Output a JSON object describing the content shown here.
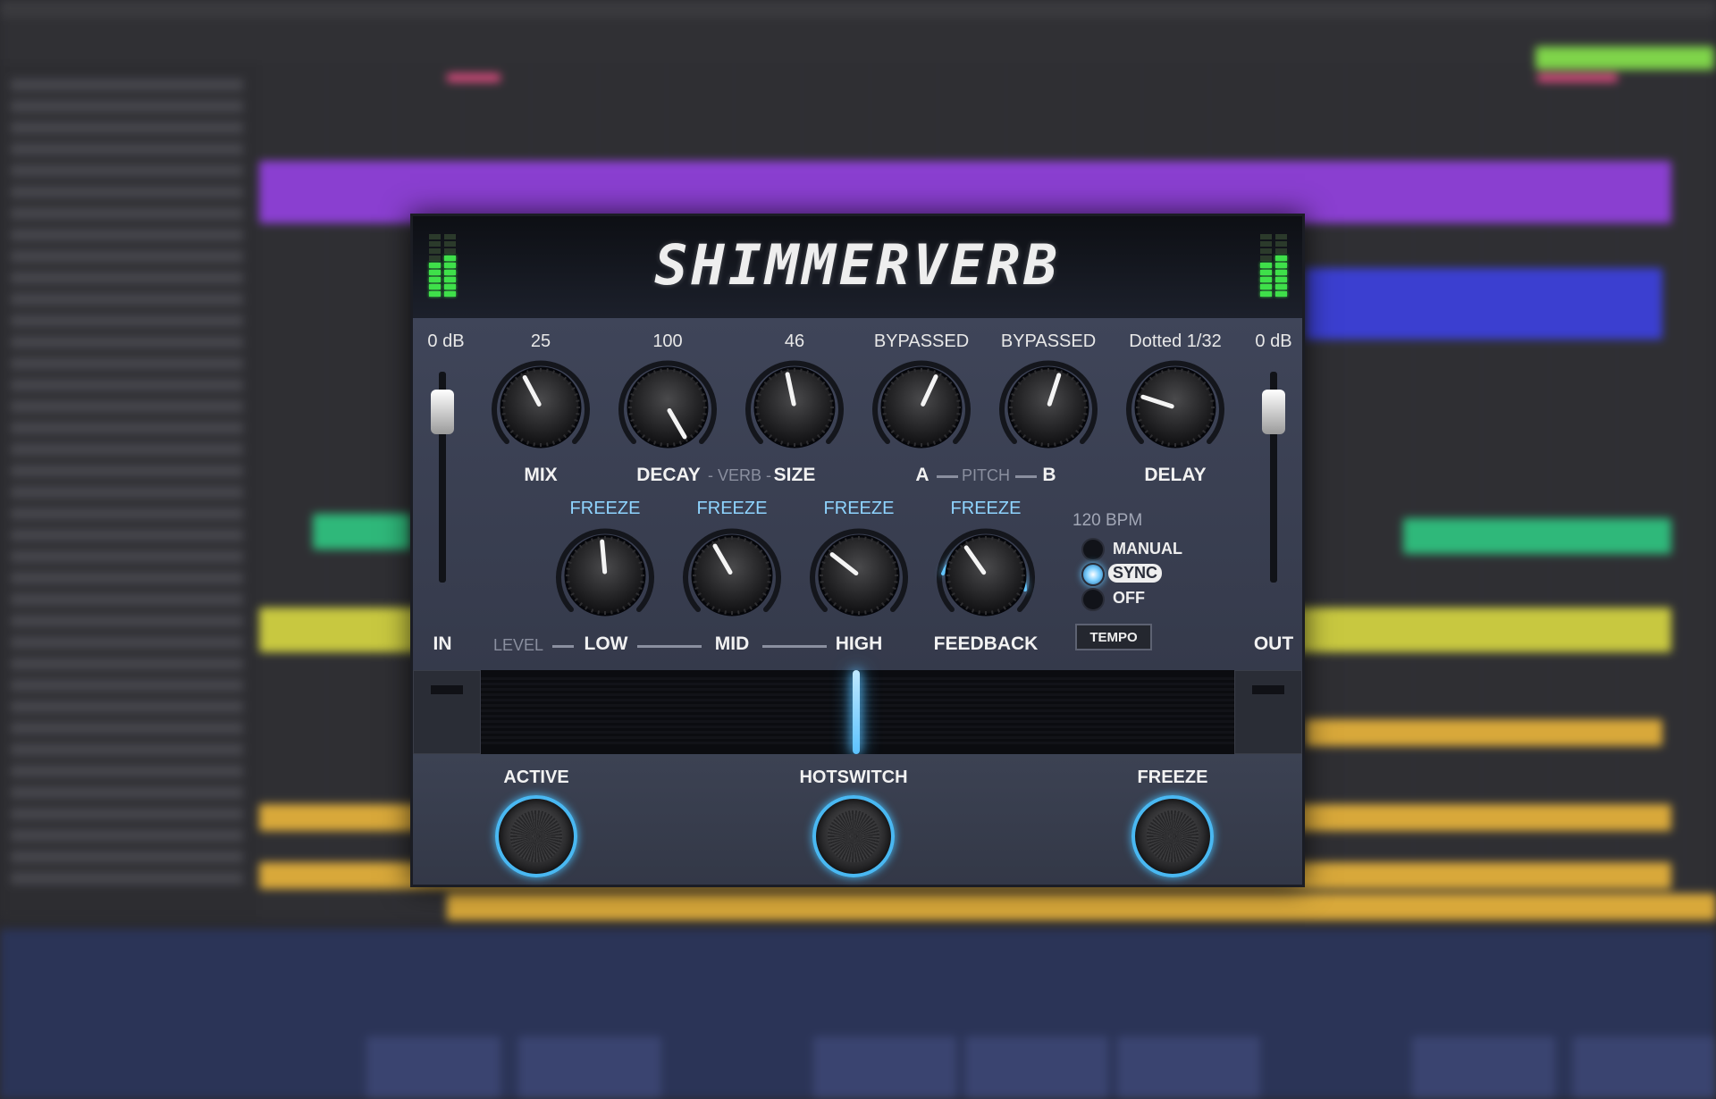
{
  "plugin": {
    "title": "SHIMMERVERB",
    "in_value": "0 dB",
    "out_value": "0 dB",
    "in_label": "IN",
    "out_label": "OUT",
    "knobs_top": [
      {
        "id": "mix",
        "value": "25",
        "label": "MIX"
      },
      {
        "id": "decay",
        "value": "100",
        "label": "DECAY"
      },
      {
        "id": "size",
        "value": "46",
        "label": "SIZE"
      },
      {
        "id": "pitch-a",
        "value": "BYPASSED",
        "label": "A"
      },
      {
        "id": "pitch-b",
        "value": "BYPASSED",
        "label": "B"
      },
      {
        "id": "delay",
        "value": "Dotted 1/32",
        "label": "DELAY"
      }
    ],
    "verb_group_label": "VERB",
    "pitch_group_label": "PITCH",
    "knobs_bottom": [
      {
        "id": "low",
        "value": "FREEZE",
        "label": "LOW"
      },
      {
        "id": "mid",
        "value": "FREEZE",
        "label": "MID"
      },
      {
        "id": "high",
        "value": "FREEZE",
        "label": "HIGH"
      },
      {
        "id": "feedback",
        "value": "FREEZE",
        "label": "FEEDBACK"
      }
    ],
    "level_label": "LEVEL",
    "bpm": "120 BPM",
    "sync_options": [
      "MANUAL",
      "SYNC",
      "OFF"
    ],
    "sync_selected": "SYNC",
    "tempo_button": "TEMPO",
    "footswitches": [
      {
        "id": "active",
        "label": "ACTIVE"
      },
      {
        "id": "hotswitch",
        "label": "HOTSWITCH"
      },
      {
        "id": "freeze",
        "label": "FREEZE"
      }
    ],
    "colors": {
      "accent": "#5cc2ff",
      "meter": "#3fe04a",
      "freeze_text": "#8fd4ff",
      "panel": "#3b4050"
    }
  }
}
